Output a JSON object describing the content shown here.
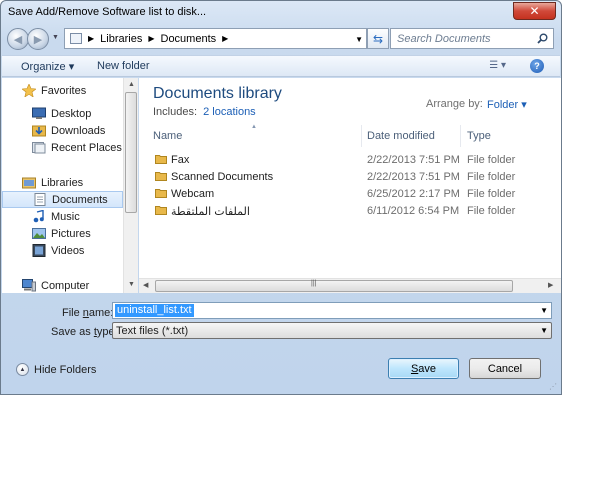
{
  "window": {
    "title": "Save Add/Remove Software list to disk...",
    "close_label": "✕"
  },
  "address_bar": {
    "breadcrumbs": [
      "Libraries",
      "Documents"
    ],
    "search_placeholder": "Search Documents"
  },
  "toolbar": {
    "organize_label": "Organize ▾",
    "new_folder_label": "New folder",
    "view_label": "☰ ▾",
    "help_label": "?"
  },
  "nav_pane": {
    "favorites_label": "Favorites",
    "favorites": [
      "Desktop",
      "Downloads",
      "Recent Places"
    ],
    "libraries_label": "Libraries",
    "libraries": [
      "Documents",
      "Music",
      "Pictures",
      "Videos"
    ],
    "computer_label": "Computer",
    "selected": "Documents"
  },
  "library_header": {
    "title": "Documents library",
    "includes_prefix": "Includes:",
    "includes_link": "2 locations",
    "arrange_label": "Arrange by:",
    "arrange_value": "Folder ▾"
  },
  "columns": {
    "name": "Name",
    "date": "Date modified",
    "type": "Type"
  },
  "files": [
    {
      "name": "Fax",
      "date": "2/22/2013 7:51 PM",
      "type": "File folder"
    },
    {
      "name": "Scanned Documents",
      "date": "2/22/2013 7:51 PM",
      "type": "File folder"
    },
    {
      "name": "Webcam",
      "date": "6/25/2012 2:17 PM",
      "type": "File folder"
    },
    {
      "name": "الملفات الملتقطة",
      "date": "6/11/2012 6:54 PM",
      "type": "File folder"
    }
  ],
  "form": {
    "file_name_label_pre": "File ",
    "file_name_label_u": "n",
    "file_name_label_post": "ame:",
    "file_name_value": "uninstall_list.txt",
    "save_type_label_pre": "Save as ",
    "save_type_label_u": "t",
    "save_type_label_post": "ype:",
    "save_type_value": "Text files (*.txt)"
  },
  "footer": {
    "hide_folders_label": "Hide Folders",
    "save_label_u": "S",
    "save_label_rest": "ave",
    "cancel_label": "Cancel"
  },
  "colors": {
    "accent": "#1c5fb6",
    "title_blue": "#1e4b7f",
    "selection": "#3399ff",
    "folder": "#e8b84a"
  }
}
